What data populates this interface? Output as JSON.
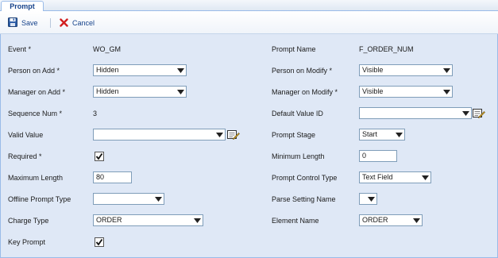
{
  "tab": {
    "label": "Prompt"
  },
  "toolbar": {
    "save_label": "Save",
    "cancel_label": "Cancel"
  },
  "left": {
    "event": {
      "label": "Event *",
      "value": "WO_GM"
    },
    "person_on_add": {
      "label": "Person on Add *",
      "value": "Hidden"
    },
    "manager_on_add": {
      "label": "Manager on Add *",
      "value": "Hidden"
    },
    "sequence_num": {
      "label": "Sequence Num *",
      "value": "3"
    },
    "valid_value": {
      "label": "Valid Value",
      "value": ""
    },
    "required": {
      "label": "Required *",
      "checked": true
    },
    "maximum_length": {
      "label": "Maximum Length",
      "value": "80"
    },
    "offline_prompt_type": {
      "label": "Offline Prompt Type",
      "value": ""
    },
    "charge_type": {
      "label": "Charge Type",
      "value": "ORDER"
    },
    "key_prompt": {
      "label": "Key Prompt",
      "checked": true
    }
  },
  "right": {
    "prompt_name": {
      "label": "Prompt Name",
      "value": "F_ORDER_NUM"
    },
    "person_on_modify": {
      "label": "Person on Modify *",
      "value": "Visible"
    },
    "manager_on_modify": {
      "label": "Manager on Modify *",
      "value": "Visible"
    },
    "default_value_id": {
      "label": "Default Value ID",
      "value": ""
    },
    "prompt_stage": {
      "label": "Prompt Stage",
      "value": "Start"
    },
    "minimum_length": {
      "label": "Minimum Length",
      "value": "0"
    },
    "prompt_control_type": {
      "label": "Prompt Control Type",
      "value": "Text Field"
    },
    "parse_setting_name": {
      "label": "Parse Setting Name",
      "value": ""
    },
    "element_name": {
      "label": "Element Name",
      "value": "ORDER"
    }
  },
  "icons": {
    "save": "floppy-disk-icon",
    "cancel": "red-x-icon",
    "picker": "edit-list-icon",
    "dropdown": "dropdown-arrow-icon"
  },
  "colors": {
    "panel_bg": "#dfe8f6",
    "tab_border": "#99bbe8",
    "link_blue": "#15428b"
  }
}
